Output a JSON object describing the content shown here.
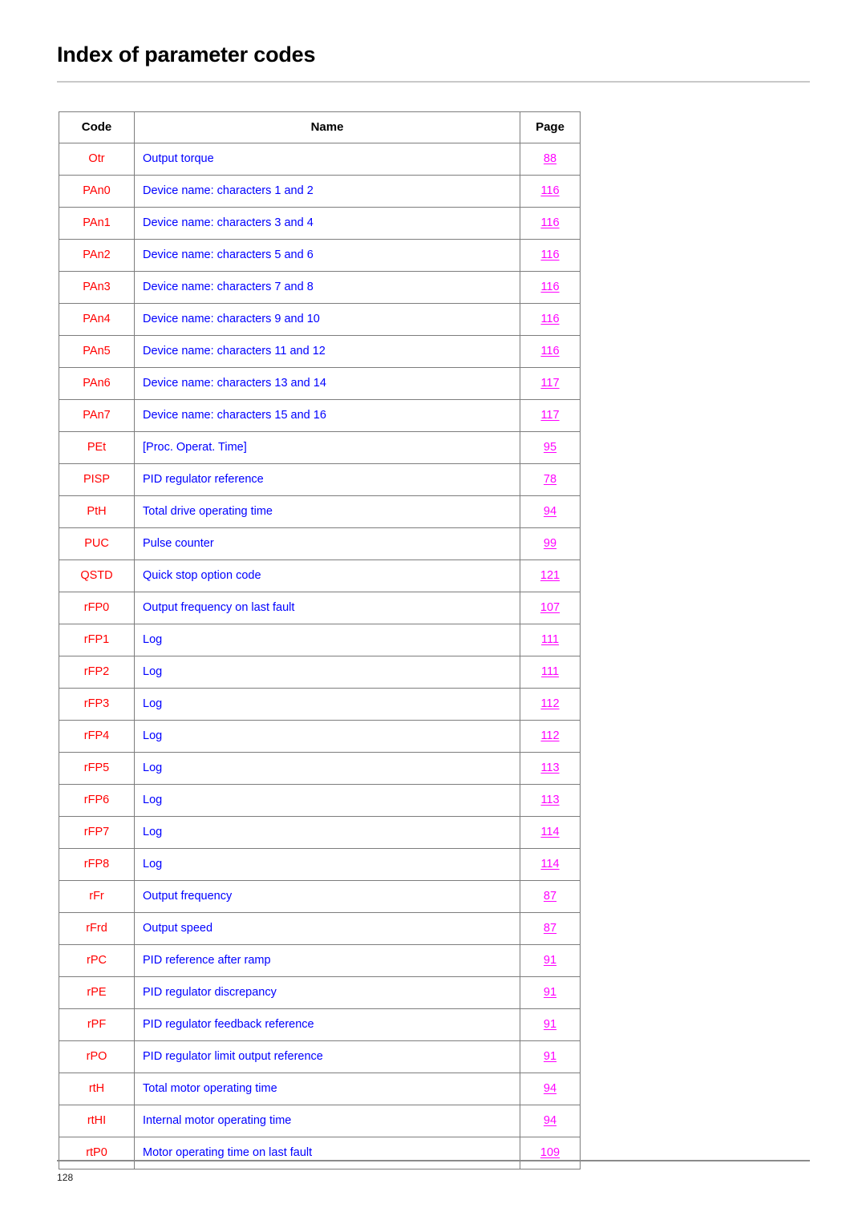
{
  "document": {
    "title": "Index of parameter codes",
    "footer_page_number": "128"
  },
  "table": {
    "headers": {
      "code": "Code",
      "name": "Name",
      "page": "Page"
    },
    "rows": [
      {
        "code": "Otr",
        "name": "Output torque",
        "page": "88"
      },
      {
        "code": "PAn0",
        "name": "Device name: characters 1 and 2",
        "page": "116"
      },
      {
        "code": "PAn1",
        "name": "Device name: characters 3 and 4",
        "page": "116"
      },
      {
        "code": "PAn2",
        "name": "Device name: characters 5 and 6",
        "page": "116"
      },
      {
        "code": "PAn3",
        "name": "Device name: characters 7 and 8",
        "page": "116"
      },
      {
        "code": "PAn4",
        "name": "Device name: characters 9 and 10",
        "page": "116"
      },
      {
        "code": "PAn5",
        "name": "Device name: characters 11 and 12",
        "page": "116"
      },
      {
        "code": "PAn6",
        "name": "Device name: characters 13 and 14",
        "page": "117"
      },
      {
        "code": "PAn7",
        "name": "Device name: characters 15 and 16",
        "page": "117"
      },
      {
        "code": "PEt",
        "name": "[Proc. Operat. Time]",
        "page": "95"
      },
      {
        "code": "PISP",
        "name": "PID regulator reference",
        "page": "78"
      },
      {
        "code": "PtH",
        "name": "Total drive operating time",
        "page": "94"
      },
      {
        "code": "PUC",
        "name": "Pulse counter",
        "page": "99"
      },
      {
        "code": "QSTD",
        "name": "Quick stop option code",
        "page": "121"
      },
      {
        "code": "rFP0",
        "name": "Output frequency on last fault",
        "page": "107"
      },
      {
        "code": "rFP1",
        "name": "Log",
        "page": "111"
      },
      {
        "code": "rFP2",
        "name": "Log",
        "page": "111"
      },
      {
        "code": "rFP3",
        "name": "Log",
        "page": "112"
      },
      {
        "code": "rFP4",
        "name": "Log",
        "page": "112"
      },
      {
        "code": "rFP5",
        "name": "Log",
        "page": "113"
      },
      {
        "code": "rFP6",
        "name": "Log",
        "page": "113"
      },
      {
        "code": "rFP7",
        "name": "Log",
        "page": "114"
      },
      {
        "code": "rFP8",
        "name": "Log",
        "page": "114"
      },
      {
        "code": "rFr",
        "name": "Output frequency",
        "page": "87"
      },
      {
        "code": "rFrd",
        "name": "Output speed",
        "page": "87"
      },
      {
        "code": "rPC",
        "name": "PID reference after ramp",
        "page": "91"
      },
      {
        "code": "rPE",
        "name": "PID regulator discrepancy",
        "page": "91"
      },
      {
        "code": "rPF",
        "name": "PID regulator feedback reference",
        "page": "91"
      },
      {
        "code": "rPO",
        "name": "PID regulator limit output reference",
        "page": "91"
      },
      {
        "code": "rtH",
        "name": "Total motor operating time",
        "page": "94"
      },
      {
        "code": "rtHI",
        "name": "Internal motor operating time",
        "page": "94"
      },
      {
        "code": "rtP0",
        "name": "Motor operating time on last fault",
        "page": "109"
      }
    ]
  },
  "colors": {
    "code_text": "#ff0000",
    "name_text": "#0000ff",
    "page_text": "#ff00ff",
    "header_text": "#000000",
    "table_border": "#7d7d7d",
    "header_rule": "#c8c8c8",
    "footer_rule": "#8a8a8a"
  }
}
